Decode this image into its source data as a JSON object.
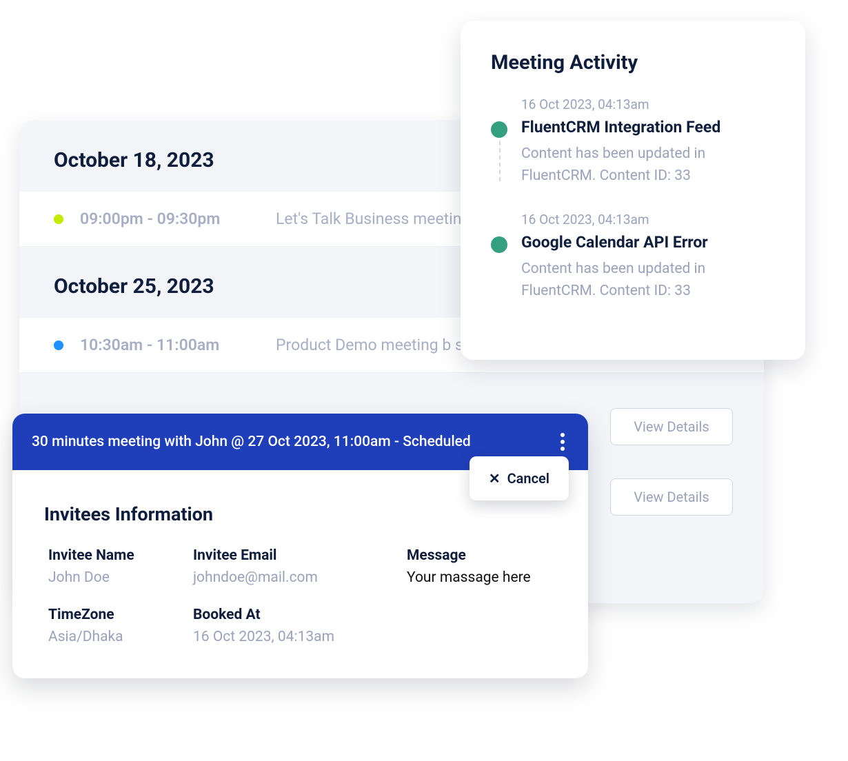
{
  "schedule": {
    "groups": [
      {
        "date_label": "October 18, 2023",
        "slots": [
          {
            "color": "lime",
            "time": "09:00pm - 09:30pm",
            "desc": "Let's Talk Business meeting Shahjahan Jewel & Mark"
          }
        ]
      },
      {
        "date_label": "October 25, 2023",
        "slots": [
          {
            "color": "blue",
            "time": "10:30am - 11:00am",
            "desc": "Product Demo meeting b suscipit q & Dolore Dolor"
          }
        ]
      }
    ]
  },
  "view_details_label": "View Details",
  "activity": {
    "title": "Meeting Activity",
    "items": [
      {
        "time": "16 Oct 2023, 04:13am",
        "heading": "FluentCRM Integration Feed",
        "body": "Content has been updated in FluentCRM. Content ID: 33"
      },
      {
        "time": "16 Oct 2023, 04:13am",
        "heading": "Google Calendar API Error",
        "body": "Content has been updated in FluentCRM. Content ID: 33"
      }
    ]
  },
  "meeting": {
    "header": "30 minutes meeting with John @ 27 Oct 2023, 11:00am - Scheduled",
    "cancel_label": "Cancel",
    "section_title": "Invitees Information",
    "fields": {
      "invitee_name_label": "Invitee Name",
      "invitee_name_value": "John Doe",
      "invitee_email_label": "Invitee Email",
      "invitee_email_value": "johndoe@mail.com",
      "message_label": "Message",
      "message_value": "Your massage here",
      "timezone_label": "TimeZone",
      "timezone_value": "Asia/Dhaka",
      "booked_label": "Booked At",
      "booked_value": "16 Oct 2023, 04:13am"
    }
  }
}
